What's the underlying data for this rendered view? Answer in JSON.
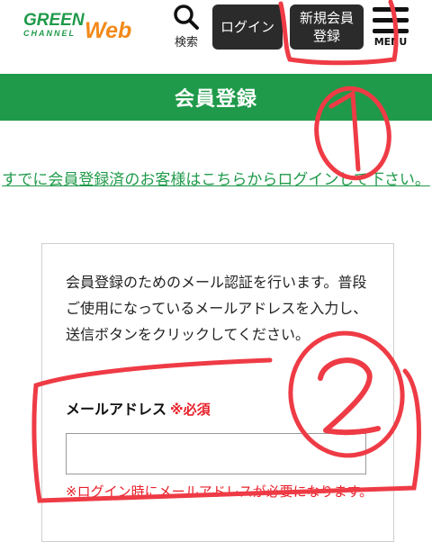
{
  "header": {
    "logo": {
      "line1": "GREEN",
      "line2": "CHANNEL",
      "web": "Web"
    },
    "search_label": "検索",
    "login_label": "ログイン",
    "register_label": "新規会員\n登録",
    "menu_label": "MENU"
  },
  "banner": {
    "title": "会員登録"
  },
  "login_link": "すでに会員登録済のお客様はこちらからログインして下さい。",
  "form": {
    "intro": "会員登録のためのメール認証を行います。普段ご使用になっているメールアドレスを入力し、送信ボタンをクリックしてください。",
    "email_label": "メールアドレス",
    "required": "※必須",
    "email_value": "",
    "note": "※ログイン時にメールアドレスが必要になります。"
  },
  "annotations": {
    "one": "①",
    "two": "②"
  },
  "colors": {
    "brand_green": "#1f9a4a",
    "required_red": "#e8202a",
    "annotation_red": "#ee3b45"
  }
}
